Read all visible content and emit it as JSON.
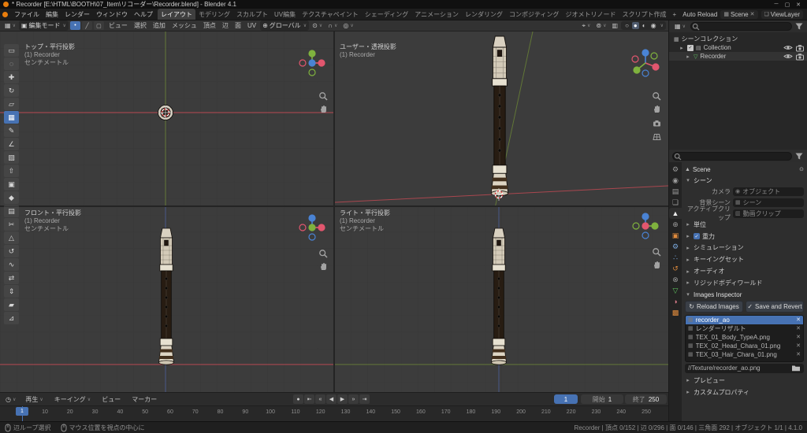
{
  "title_bar": {
    "title": "* Recorder [E:\\HTML\\BOOTH\\07_Item\\リコーダー\\Recorder.blend] - Blender 4.1"
  },
  "icons": {
    "collapse_arrow": "▸",
    "expand_arrow": "▾",
    "chevron_down": "∨",
    "close": "✕",
    "check": "✓",
    "minimize": "─",
    "maximize": "▢",
    "window_close": "✕",
    "editor_type": "▦",
    "edit_mode_icon": "▣",
    "globe": "⊕",
    "pivot": "⊙",
    "magnet": "∩",
    "proportional": "◎",
    "show_gizmo": "⌖",
    "overlays": "⊚",
    "xray": "▥",
    "shading_wireframe": "○",
    "shading_solid": "●",
    "shading_material": "◐",
    "shading_rendered": "◉",
    "scene_browse": "▦",
    "view_layer": "❏",
    "clock": "◷",
    "pin": "⊙",
    "scene_breadcrumb": "▲",
    "image": "▦",
    "reload": "↻",
    "save": "✓",
    "collection": "▤",
    "scene_collection": "▦",
    "mesh_data": "▽"
  },
  "menu_bar": {
    "menus": [
      "ファイル",
      "編集",
      "レンダー",
      "ウィンドウ",
      "ヘルプ"
    ],
    "workspaces": [
      {
        "label": "レイアウト",
        "active": true
      },
      {
        "label": "モデリング"
      },
      {
        "label": "スカルプト"
      },
      {
        "label": "UV編集"
      },
      {
        "label": "テクスチャペイント"
      },
      {
        "label": "シェーディング"
      },
      {
        "label": "アニメーション"
      },
      {
        "label": "レンダリング"
      },
      {
        "label": "コンポジティング"
      },
      {
        "label": "ジオメトリノード"
      },
      {
        "label": "スクリプト作成"
      }
    ],
    "add_workspace": "+",
    "auto_reload_label": "Auto Reload",
    "scene_label": "Scene",
    "view_layer_label": "ViewLayer"
  },
  "viewport_header": {
    "mode_label": "編集モード",
    "select_modes": [
      {
        "glyph": "•",
        "name": "vertex-select-mode-button",
        "active": true
      },
      {
        "glyph": "╱",
        "name": "edge-select-mode-button"
      },
      {
        "glyph": "▢",
        "name": "face-select-mode-button"
      }
    ],
    "menus": [
      "ビュー",
      "選択",
      "追加",
      "メッシュ",
      "頂点",
      "辺",
      "面",
      "UV"
    ],
    "orientation_label": "グローバル"
  },
  "toolbar": {
    "tools": [
      {
        "glyph": "▭",
        "name": "select-box-tool"
      },
      {
        "glyph": "◌",
        "name": "cursor-tool"
      },
      {
        "glyph": "✚",
        "name": "move-tool"
      },
      {
        "glyph": "↻",
        "name": "rotate-tool"
      },
      {
        "glyph": "▱",
        "name": "scale-tool"
      },
      {
        "glyph": "▦",
        "name": "transform-tool",
        "active": true
      },
      {
        "glyph": "✎",
        "name": "annotate-tool"
      },
      {
        "glyph": "∠",
        "name": "measure-tool"
      },
      {
        "glyph": "▧",
        "name": "add-cube-tool"
      },
      {
        "glyph": "⇧",
        "name": "extrude-region-tool"
      },
      {
        "glyph": "▣",
        "name": "inset-faces-tool"
      },
      {
        "glyph": "◆",
        "name": "bevel-tool"
      },
      {
        "glyph": "▤",
        "name": "loop-cut-tool"
      },
      {
        "glyph": "✂",
        "name": "knife-tool"
      },
      {
        "glyph": "△",
        "name": "poly-build-tool"
      },
      {
        "glyph": "↺",
        "name": "spin-tool"
      },
      {
        "glyph": "∿",
        "name": "smooth-tool"
      },
      {
        "glyph": "⇄",
        "name": "edge-slide-tool"
      },
      {
        "glyph": "⇕",
        "name": "shrink-fatten-tool"
      },
      {
        "glyph": "▰",
        "name": "shear-tool"
      },
      {
        "glyph": "⊿",
        "name": "rip-region-tool"
      }
    ]
  },
  "viewports": {
    "top_left": {
      "view_label": "トップ・平行投影",
      "object_label": "(1) Recorder",
      "unit_label": "センチメートル"
    },
    "top_right": {
      "view_label": "ユーザー・透視投影",
      "object_label": "(1) Recorder"
    },
    "bottom_left": {
      "view_label": "フロント・平行投影",
      "object_label": "(1) Recorder",
      "unit_label": "センチメートル"
    },
    "bottom_right": {
      "view_label": "ライト・平行投影",
      "object_label": "(1) Recorder",
      "unit_label": "センチメートル"
    }
  },
  "outliner": {
    "search_value": "",
    "rows": {
      "scene_collection": "シーンコレクション",
      "collection": "Collection",
      "object": "Recorder"
    }
  },
  "properties": {
    "search_value": "",
    "tabs": [
      {
        "glyph": "⚙",
        "name": "tool-tab"
      },
      {
        "glyph": "◉",
        "name": "render-tab"
      },
      {
        "glyph": "▤",
        "name": "output-tab"
      },
      {
        "glyph": "❏",
        "name": "view-layer-tab"
      },
      {
        "glyph": "▲",
        "name": "scene-tab",
        "active": true
      },
      {
        "glyph": "⊕",
        "name": "world-tab"
      },
      {
        "glyph": "▣",
        "name": "object-tab",
        "color": "#de8a3c"
      },
      {
        "glyph": "⚙",
        "name": "modifiers-tab",
        "color": "#7aa8dc"
      },
      {
        "glyph": "∴",
        "name": "particles-tab",
        "color": "#7aa8dc"
      },
      {
        "glyph": "↺",
        "name": "physics-tab",
        "color": "#de8a3c"
      },
      {
        "glyph": "⊗",
        "name": "constraints-tab"
      },
      {
        "glyph": "▽",
        "name": "object-data-tab",
        "color": "#5fc45f"
      },
      {
        "glyph": "◑",
        "name": "material-tab",
        "color": "#d87b8a"
      },
      {
        "glyph": "▩",
        "name": "texture-tab",
        "color": "#de8a3c"
      }
    ],
    "breadcrumb": "Scene",
    "scene_section_label": "シーン",
    "scene_fields": [
      {
        "label": "カメラ",
        "value": "オブジェクト",
        "icon": "◉",
        "name": "camera-field-row"
      },
      {
        "label": "背景シーン",
        "value": "シーン",
        "icon": "▦",
        "name": "background-scene-field-row"
      },
      {
        "label": "アクティブクリップ",
        "value": "動画クリップ",
        "icon": "▥",
        "name": "active-clip-field-row"
      }
    ],
    "collapsed_sections": [
      {
        "label": "単位"
      },
      {
        "label": "重力",
        "checkbox": true
      },
      {
        "label": "シミュレーション"
      },
      {
        "label": "キーイングセット"
      },
      {
        "label": "オーディオ"
      },
      {
        "label": "リジッドボディワールド"
      }
    ],
    "images_inspector": {
      "title": "Images Inspector",
      "reload_label": "Reload Images",
      "save_label": "Save and Revert",
      "images": [
        {
          "label": "recorder_ao",
          "active": true
        },
        {
          "label": "レンダーリザルト"
        },
        {
          "label": "TEX_01_Body_TypeA.png"
        },
        {
          "label": "TEX_02_Head_Chara_01.png"
        },
        {
          "label": "TEX_03_Hair_Chara_01.png"
        }
      ],
      "path_value": "//Texture/recorder_ao.png"
    },
    "bottom_sections": [
      {
        "label": "プレビュー"
      },
      {
        "label": "カスタムプロパティ"
      }
    ]
  },
  "timeline": {
    "menus": [
      {
        "label": "再生",
        "chevron": true
      },
      {
        "label": "キーイング",
        "chevron": true
      },
      {
        "label": "ビュー"
      },
      {
        "label": "マーカー"
      }
    ],
    "transport": [
      {
        "glyph": "●",
        "name": "auto-keying-button"
      },
      {
        "glyph": "⇤",
        "name": "jump-to-start-button"
      },
      {
        "glyph": "«",
        "name": "previous-keyframe-button"
      },
      {
        "glyph": "◀",
        "name": "play-reverse-button"
      },
      {
        "glyph": "▶",
        "name": "play-button"
      },
      {
        "glyph": "»",
        "name": "next-keyframe-button"
      },
      {
        "glyph": "⇥",
        "name": "jump-to-end-button"
      }
    ],
    "current_frame": "1",
    "start_label": "開始",
    "start_value": "1",
    "end_label": "終了",
    "end_value": "250",
    "ticks": [
      "10",
      "20",
      "30",
      "40",
      "50",
      "60",
      "70",
      "80",
      "90",
      "100",
      "110",
      "120",
      "130",
      "140",
      "150",
      "160",
      "170",
      "180",
      "190",
      "200",
      "210",
      "220",
      "230",
      "240",
      "250"
    ]
  },
  "status_bar": {
    "hint_primary": "辺ループ選択",
    "hint_secondary": "マウス位置を視点の中心に",
    "stats": "Recorder | 頂点 0/152 | 辺 0/296 | 面 0/146 | 三角面 292 | オブジェクト 1/1 | 4.1.0"
  },
  "colors": {
    "accent": "#4772b3",
    "x_axis": "#c34a52",
    "y_axis": "#6c8a37",
    "z_axis": "#4a5e96",
    "gizmo_x": "#e2566e",
    "gizmo_y": "#7fb23e",
    "gizmo_z": "#4a83d4"
  }
}
